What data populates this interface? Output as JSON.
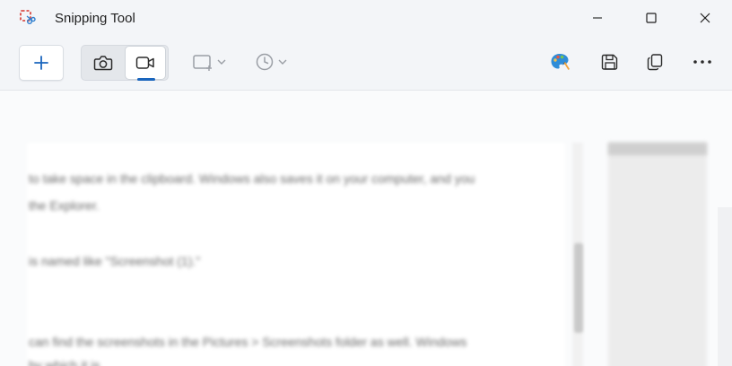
{
  "window": {
    "title": "Snipping Tool",
    "controls": [
      "minimize",
      "maximize",
      "close"
    ]
  },
  "toolbar": {
    "new_button": "plus-icon",
    "modes": [
      {
        "name": "Snip mode",
        "icon": "camera-icon",
        "selected": false
      },
      {
        "name": "Record mode",
        "icon": "video-camera-icon",
        "selected": true
      }
    ],
    "dropdowns": [
      {
        "icon": "snip-shape-icon"
      },
      {
        "icon": "delay-clock-icon"
      }
    ],
    "actions": [
      "paint-palette-icon",
      "save-icon",
      "copy-icon",
      "more-icon"
    ]
  },
  "colors": {
    "accent": "#1a65bd",
    "titlebar_bg": "#f3f5f8",
    "content_bg": "#fafbfc"
  },
  "preview": {
    "lines": [
      "to take space in the clipboard. Windows also saves it on your computer, and you",
      "the Explorer.",
      "is named like \"Screenshot (1).\"",
      "can find the screenshots in the Pictures > Screenshots folder as well. Windows",
      "by which it is"
    ]
  }
}
